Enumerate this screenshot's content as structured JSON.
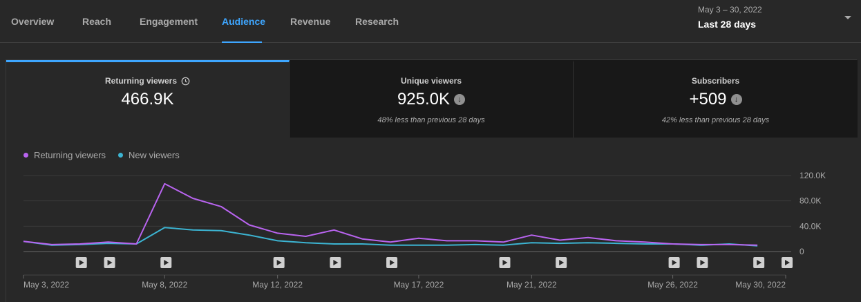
{
  "tabs": [
    {
      "label": "Overview",
      "active": false
    },
    {
      "label": "Reach",
      "active": false
    },
    {
      "label": "Engagement",
      "active": false
    },
    {
      "label": "Audience",
      "active": true
    },
    {
      "label": "Revenue",
      "active": false
    },
    {
      "label": "Research",
      "active": false
    }
  ],
  "date_range": {
    "range_text": "May 3 – 30, 2022",
    "label": "Last 28 days"
  },
  "metrics": [
    {
      "label": "Returning viewers",
      "value": "466.9K",
      "note": "",
      "icon": "clock-icon"
    },
    {
      "label": "Unique viewers",
      "value": "925.0K",
      "note": "48% less than previous 28 days",
      "icon": "arrow-down-icon"
    },
    {
      "label": "Subscribers",
      "value": "+509",
      "note": "42% less than previous 28 days",
      "icon": "arrow-down-icon"
    }
  ],
  "colors": {
    "accent": "#3ea6ff",
    "returning": "#b964f0",
    "new": "#3cb4d2"
  },
  "chart_data": {
    "type": "line",
    "x": [
      "May 3, 2022",
      "May 4, 2022",
      "May 5, 2022",
      "May 6, 2022",
      "May 7, 2022",
      "May 8, 2022",
      "May 9, 2022",
      "May 10, 2022",
      "May 11, 2022",
      "May 12, 2022",
      "May 13, 2022",
      "May 14, 2022",
      "May 15, 2022",
      "May 16, 2022",
      "May 17, 2022",
      "May 18, 2022",
      "May 19, 2022",
      "May 20, 2022",
      "May 21, 2022",
      "May 22, 2022",
      "May 23, 2022",
      "May 24, 2022",
      "May 25, 2022",
      "May 26, 2022",
      "May 27, 2022",
      "May 28, 2022",
      "May 29, 2022"
    ],
    "series": [
      {
        "name": "Returning viewers",
        "color": "#b964f0",
        "values": [
          16,
          11,
          12,
          15,
          12,
          107,
          84,
          71,
          42,
          29,
          24,
          34,
          20,
          15,
          21,
          17,
          17,
          15,
          26,
          18,
          22,
          17,
          15,
          12,
          11,
          11,
          10
        ]
      },
      {
        "name": "New viewers",
        "color": "#3cb4d2",
        "values": [
          16,
          10,
          11,
          13,
          12,
          38,
          34,
          33,
          26,
          17,
          14,
          12,
          12,
          10,
          10,
          10,
          11,
          10,
          14,
          13,
          14,
          13,
          12,
          12,
          10,
          12,
          9
        ]
      }
    ],
    "x_tick_labels": [
      "May 3, 2022",
      "May 8, 2022",
      "May 12, 2022",
      "May 17, 2022",
      "May 21, 2022",
      "May 26, 2022",
      "May 30, 2022"
    ],
    "x_tick_index": [
      0,
      5,
      9,
      14,
      18,
      23,
      27
    ],
    "y_ticks": [
      0,
      40,
      80,
      120
    ],
    "y_tick_labels": [
      "0",
      "40.0K",
      "80.0K",
      "120.0K"
    ],
    "ylim": [
      0,
      120
    ],
    "y_unit": "thousands of viewers",
    "incomplete_day_index": 27,
    "video_markers_index": [
      2,
      3,
      5,
      9,
      11,
      13,
      17,
      19,
      23,
      24,
      26,
      27
    ],
    "legend_position": "top-left",
    "grid": true
  }
}
